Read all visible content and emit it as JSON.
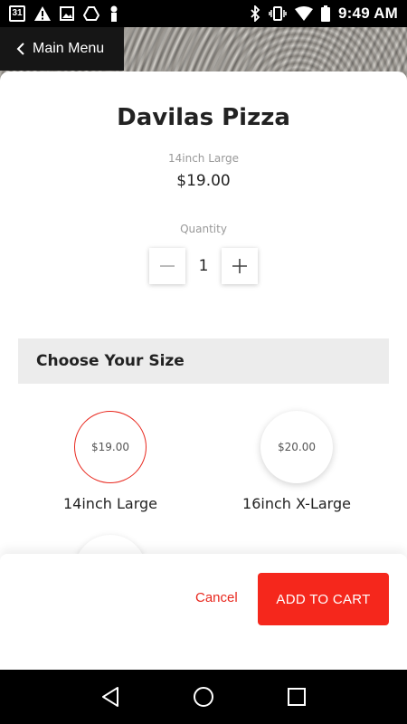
{
  "status_bar": {
    "calendar_day": "31",
    "time": "9:49 AM",
    "icons": [
      "calendar-icon",
      "warning-icon",
      "image-icon",
      "drive-icon",
      "person-icon",
      "bluetooth-icon",
      "vibrate-icon",
      "wifi-icon",
      "battery-icon"
    ]
  },
  "header": {
    "back_label": "Main Menu"
  },
  "product": {
    "name": "Davilas Pizza",
    "size": "14inch Large",
    "price": "$19.00"
  },
  "quantity": {
    "label": "Quantity",
    "value": "1"
  },
  "size_section": {
    "title": "Choose Your Size",
    "options": [
      {
        "price": "$19.00",
        "name": "14inch Large",
        "selected": true
      },
      {
        "price": "$20.00",
        "name": "16inch X-Large",
        "selected": false
      }
    ]
  },
  "actions": {
    "cancel_label": "Cancel",
    "add_to_cart_label": "ADD TO CART"
  },
  "colors": {
    "accent": "#f5271c",
    "header_button_bg": "#161616",
    "section_bg": "#ececec"
  }
}
